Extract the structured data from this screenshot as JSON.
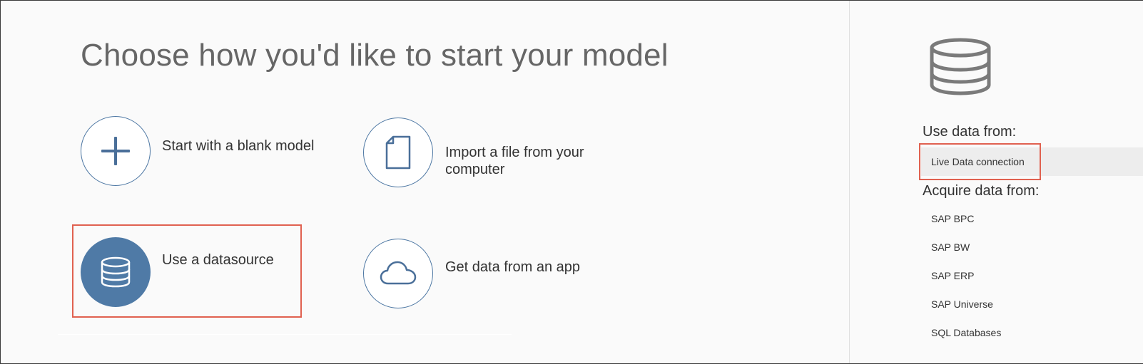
{
  "main": {
    "title": "Choose how you'd like to start your model",
    "options": [
      {
        "label": "Start with a blank model",
        "icon": "plus-icon"
      },
      {
        "label": "Import a file from your computer",
        "icon": "file-icon"
      },
      {
        "label": "Use a datasource",
        "icon": "database-icon",
        "selected": true
      },
      {
        "label": "Get data from an app",
        "icon": "cloud-icon"
      }
    ]
  },
  "side_panel": {
    "icon": "database-icon",
    "use_data_heading": "Use data from:",
    "use_data_items": [
      "Live Data connection"
    ],
    "acquire_data_heading": "Acquire data from:",
    "acquire_data_items": [
      "SAP BPC",
      "SAP BW",
      "SAP ERP",
      "SAP Universe",
      "SQL Databases"
    ]
  },
  "colors": {
    "accent_blue": "#4f7aa6",
    "highlight_red": "#e06150",
    "title_gray": "#666666"
  }
}
